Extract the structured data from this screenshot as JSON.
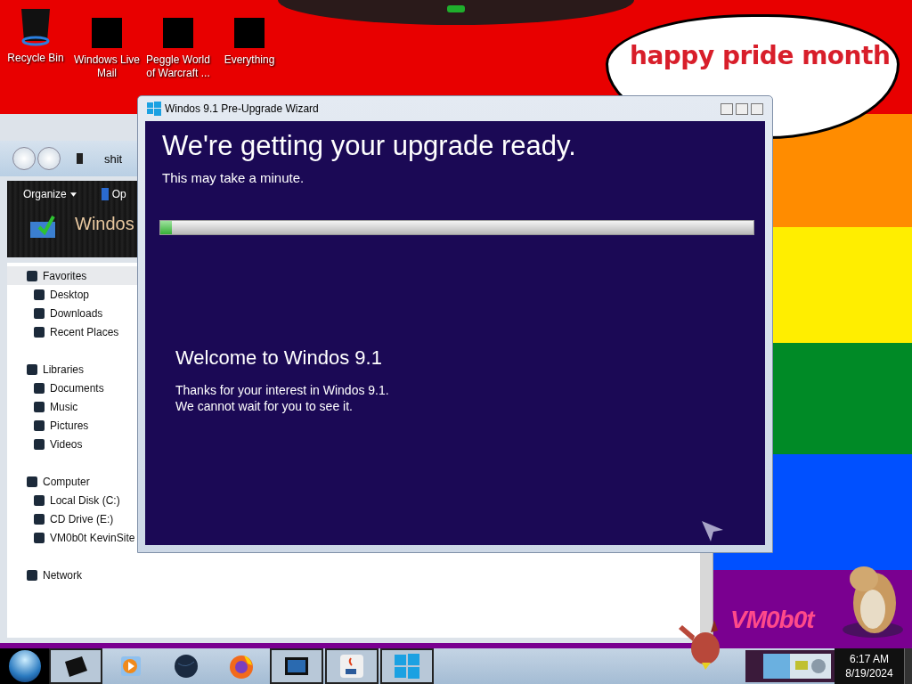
{
  "desktop": {
    "icons": [
      {
        "label": "Recycle Bin",
        "kind": "bin"
      },
      {
        "label": "Windows Live Mail",
        "kind": "censored"
      },
      {
        "label": "Peggle World of Warcraft ...",
        "kind": "censored"
      },
      {
        "label": "Everything",
        "kind": "censored"
      }
    ],
    "speech_bubble": [
      "happy pride month"
    ],
    "wallpaper_text": "VM0b0t"
  },
  "explorer": {
    "address": "shit",
    "toolbar": [
      "Organize",
      "Op"
    ],
    "header": "Windos",
    "nav": [
      {
        "label": "Favorites",
        "selected": true,
        "children": [
          {
            "label": "Desktop",
            "selected": false
          },
          {
            "label": "Downloads",
            "selected": false
          },
          {
            "label": "Recent Places",
            "selected": false
          }
        ]
      },
      {
        "label": "Libraries",
        "selected": false,
        "children": [
          {
            "label": "Documents",
            "selected": false
          },
          {
            "label": "Music",
            "selected": false
          },
          {
            "label": "Pictures",
            "selected": false
          },
          {
            "label": "Videos",
            "selected": false
          }
        ]
      },
      {
        "label": "Computer",
        "selected": false,
        "children": [
          {
            "label": "Local Disk (C:)",
            "selected": false
          },
          {
            "label": "CD Drive (E:)",
            "selected": false
          },
          {
            "label": "VM0b0t KevinSite",
            "selected": false
          }
        ]
      },
      {
        "label": "Network",
        "selected": false
      }
    ]
  },
  "wizard": {
    "title": "Windos 9.1 Pre-Upgrade Wizard",
    "heading": "We're getting your upgrade ready.",
    "subheading": "This may take a minute.",
    "progress": {
      "level": 0.02
    },
    "welcome_title": "Welcome to Windos 9.1",
    "welcome_text": [
      "Thanks for your interest in Windos 9.1.",
      "We cannot wait for you to see it."
    ]
  },
  "taskbar": {
    "items": [
      {
        "kind": "drive",
        "running": true
      },
      {
        "kind": "media",
        "running": false
      },
      {
        "kind": "globe",
        "running": false
      },
      {
        "kind": "browser",
        "running": false
      },
      {
        "kind": "monitor",
        "running": true
      },
      {
        "kind": "java",
        "running": true
      },
      {
        "kind": "windows",
        "running": true
      }
    ],
    "clock": {
      "time": "6:17 AM",
      "date": "8/19/2024"
    }
  }
}
